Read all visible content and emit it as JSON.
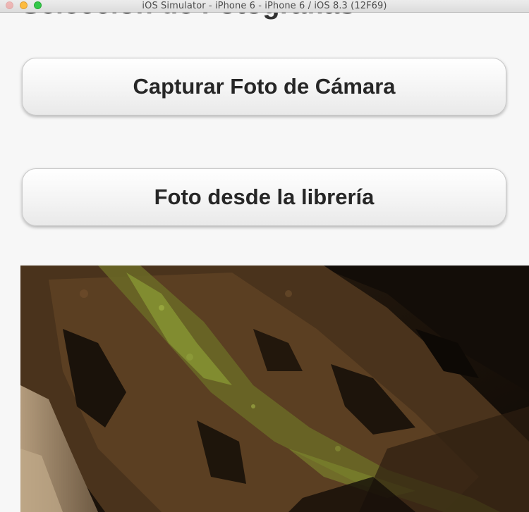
{
  "window": {
    "title": "iOS Simulator - iPhone 6 - iPhone 6 / iOS 8.3 (12F69)"
  },
  "page": {
    "heading": "Selección de Fotografías"
  },
  "buttons": {
    "camera_label": "Capturar Foto de Cámara",
    "library_label": "Foto desde la librería"
  },
  "photo": {
    "subject": "rocky cliff with moss"
  }
}
